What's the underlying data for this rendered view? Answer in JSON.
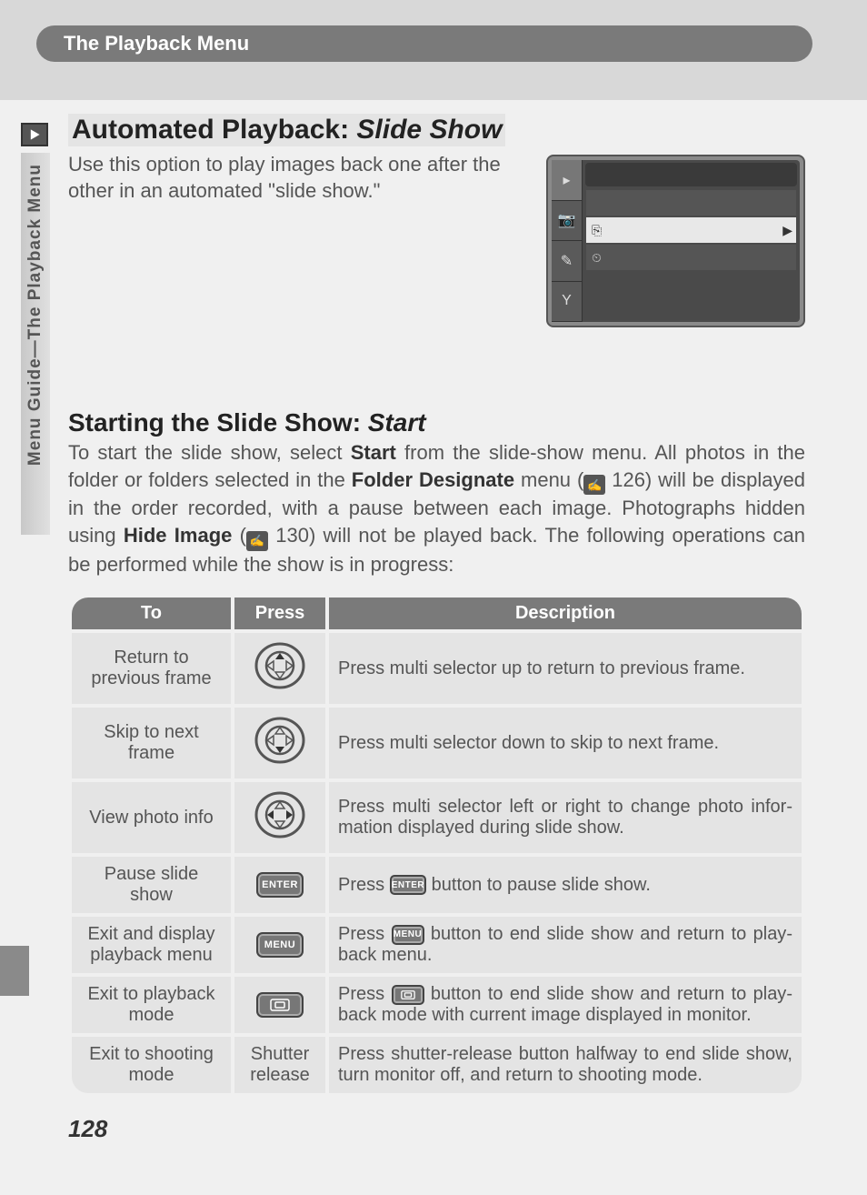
{
  "header": {
    "tab": "The Playback Menu"
  },
  "sidebar": {
    "text": "Menu Guide—The Playback Menu"
  },
  "section": {
    "title_a": "Automated Playback: ",
    "title_b": "Slide Show",
    "intro": "Use this option to play images back one after the other in an automated \"slide show.\""
  },
  "subsection": {
    "title_a": "Starting the Slide Show: ",
    "title_b": "Start",
    "p1a": "To start the slide show, select ",
    "p1b": "Start",
    "p1c": " from the slide-show menu.  All photos in the folder or folders selected in the ",
    "p1d": "Folder Designate",
    "p1e": " menu (",
    "p1f": " 126) will be displayed in the order recorded, with a pause between each image.  Photo­graphs hidden using ",
    "p1g": "Hide Image",
    "p1h": " (",
    "p1i": " 130) will not be played back.  The following operations can be performed while the show is in progress:"
  },
  "table": {
    "h1": "To",
    "h2": "Press",
    "h3": "Description",
    "rows": [
      {
        "to": "Return to previous frame",
        "press": "ms-up",
        "desc": "Press multi selector up to return to previous frame."
      },
      {
        "to": "Skip to next frame",
        "press": "ms-down",
        "desc": "Press multi selector down to skip to next frame."
      },
      {
        "to": "View photo info",
        "press": "ms-lr",
        "desc": "Press multi selector left or right to change photo infor­mation displayed during slide show."
      },
      {
        "to": "Pause slide show",
        "press": "ENTER",
        "desc_a": "Press ",
        "desc_btn": "ENTER",
        "desc_b": " button to pause slide show."
      },
      {
        "to": "Exit and display playback menu",
        "press": "MENU",
        "desc_a": "Press ",
        "desc_btn": "MENU",
        "desc_b": " button to end slide show and return to play­back menu."
      },
      {
        "to": "Exit to playback mode",
        "press": "MON",
        "desc_a": "Press ",
        "desc_btn": "MON",
        "desc_b": " button to end slide show and return to play­back mode with current image displayed in monitor."
      },
      {
        "to": "Exit to shooting mode",
        "press": "Shutter release",
        "desc": "Press shutter-release button halfway to end slide show, turn monitor off, and return to shooting mode."
      }
    ]
  },
  "page_number": "128",
  "icons": {
    "enter_label": "ENTER",
    "menu_label": "MENU"
  }
}
